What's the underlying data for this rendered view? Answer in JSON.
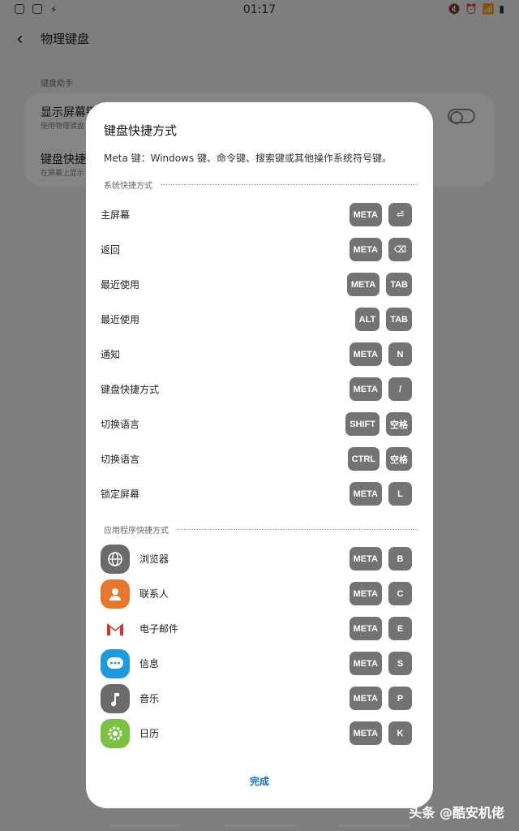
{
  "status_bar": {
    "time": "01:17",
    "left_icons": [
      "instagram-icon",
      "image-icon",
      "bolt-icon"
    ],
    "right_icons": [
      "mute-icon",
      "alarm-icon",
      "wifi-icon",
      "battery-icon"
    ]
  },
  "background": {
    "title": "物理键盘",
    "section_header": "键盘助手",
    "row1_title": "显示屏幕键",
    "row1_sub": "使用物理键盘",
    "row2_title": "键盘快捷",
    "row2_sub": "在屏幕上显示"
  },
  "dialog": {
    "title": "键盘快捷方式",
    "description": "Meta 键：Windows 键、命令键、搜索键或其他操作系统符号键。",
    "system_group_label": "系统快捷方式",
    "app_group_label": "应用程序快捷方式",
    "system_shortcuts": [
      {
        "label": "主屏幕",
        "keys": [
          "META",
          "⏎"
        ]
      },
      {
        "label": "返回",
        "keys": [
          "META",
          "⌫"
        ]
      },
      {
        "label": "最近使用",
        "keys": [
          "META",
          "TAB"
        ]
      },
      {
        "label": "最近使用",
        "keys": [
          "ALT",
          "TAB"
        ]
      },
      {
        "label": "通知",
        "keys": [
          "META",
          "N"
        ]
      },
      {
        "label": "键盘快捷方式",
        "keys": [
          "META",
          "/"
        ]
      },
      {
        "label": "切换语言",
        "keys": [
          "SHIFT",
          "空格"
        ]
      },
      {
        "label": "切换语言",
        "keys": [
          "CTRL",
          "空格"
        ]
      },
      {
        "label": "锁定屏幕",
        "keys": [
          "META",
          "L"
        ]
      }
    ],
    "app_shortcuts": [
      {
        "label": "浏览器",
        "icon": "globe-icon",
        "color": "#6b6b6b",
        "keys": [
          "META",
          "B"
        ]
      },
      {
        "label": "联系人",
        "icon": "contact-icon",
        "color": "#e8772e",
        "keys": [
          "META",
          "C"
        ]
      },
      {
        "label": "电子邮件",
        "icon": "gmail-icon",
        "color": "#ffffff",
        "keys": [
          "META",
          "E"
        ]
      },
      {
        "label": "信息",
        "icon": "message-icon",
        "color": "#1e9be0",
        "keys": [
          "META",
          "S"
        ]
      },
      {
        "label": "音乐",
        "icon": "music-icon",
        "color": "#6b6b6b",
        "keys": [
          "META",
          "P"
        ]
      },
      {
        "label": "日历",
        "icon": "gear-icon",
        "color": "#7cc242",
        "keys": [
          "META",
          "K"
        ]
      }
    ],
    "done_label": "完成"
  },
  "watermark": "头条 @酷安机佬"
}
